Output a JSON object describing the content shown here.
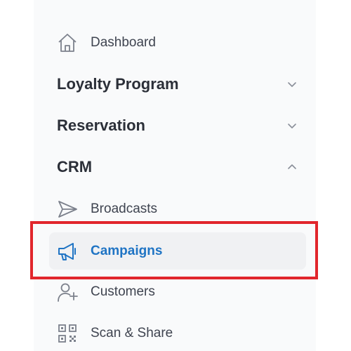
{
  "sidebar": {
    "dashboard": {
      "label": "Dashboard",
      "icon": "home-icon"
    },
    "sections": [
      {
        "label": "Loyalty Program",
        "expanded": false,
        "icon": "chevron-down-icon"
      },
      {
        "label": "Reservation",
        "expanded": false,
        "icon": "chevron-down-icon"
      },
      {
        "label": "CRM",
        "expanded": true,
        "icon": "chevron-up-icon"
      }
    ],
    "crm_items": [
      {
        "label": "Broadcasts",
        "icon": "send-icon",
        "active": false
      },
      {
        "label": "Campaigns",
        "icon": "megaphone-icon",
        "active": true
      },
      {
        "label": "Customers",
        "icon": "add-user-icon",
        "active": false
      },
      {
        "label": "Scan & Share",
        "icon": "qr-code-icon",
        "active": false
      }
    ]
  },
  "colors": {
    "active_text": "#1f74c4",
    "active_background": "#f0f1f3",
    "highlight_border": "#e1262c",
    "sidebar_background": "#f9fafb"
  }
}
